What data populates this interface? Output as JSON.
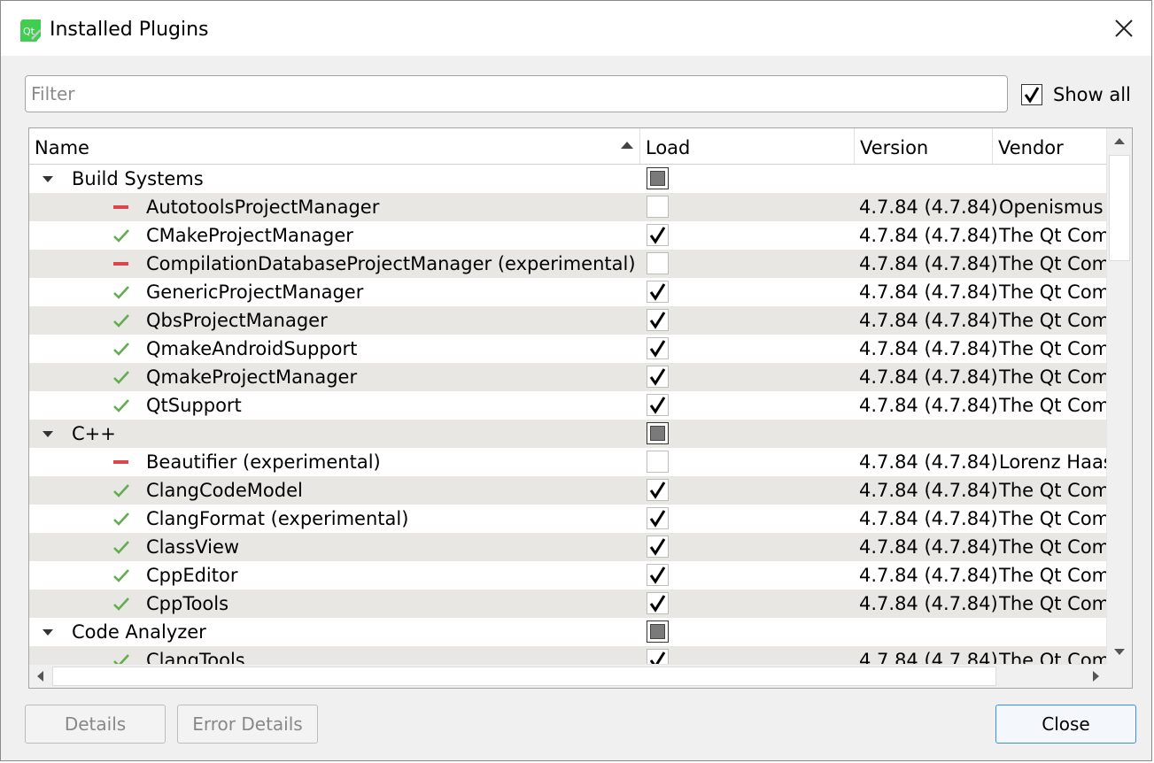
{
  "window": {
    "title": "Installed Plugins",
    "app_icon_text": "Qt"
  },
  "filter": {
    "placeholder": "Filter",
    "value": ""
  },
  "show_all": {
    "label": "Show all",
    "checked": true
  },
  "columns": [
    "Name",
    "Load",
    "Version",
    "Vendor"
  ],
  "groups": [
    {
      "name": "Build Systems",
      "plugins": [
        {
          "name": "AutotoolsProjectManager",
          "loaded": false,
          "version": "4.7.84 (4.7.84)",
          "vendor": "Openismus"
        },
        {
          "name": "CMakeProjectManager",
          "loaded": true,
          "version": "4.7.84 (4.7.84)",
          "vendor": "The Qt Com"
        },
        {
          "name": "CompilationDatabaseProjectManager (experimental)",
          "loaded": false,
          "version": "4.7.84 (4.7.84)",
          "vendor": "The Qt Com"
        },
        {
          "name": "GenericProjectManager",
          "loaded": true,
          "version": "4.7.84 (4.7.84)",
          "vendor": "The Qt Com"
        },
        {
          "name": "QbsProjectManager",
          "loaded": true,
          "version": "4.7.84 (4.7.84)",
          "vendor": "The Qt Com"
        },
        {
          "name": "QmakeAndroidSupport",
          "loaded": true,
          "version": "4.7.84 (4.7.84)",
          "vendor": "The Qt Com"
        },
        {
          "name": "QmakeProjectManager",
          "loaded": true,
          "version": "4.7.84 (4.7.84)",
          "vendor": "The Qt Com"
        },
        {
          "name": "QtSupport",
          "loaded": true,
          "version": "4.7.84 (4.7.84)",
          "vendor": "The Qt Com"
        }
      ]
    },
    {
      "name": "C++",
      "plugins": [
        {
          "name": "Beautifier (experimental)",
          "loaded": false,
          "version": "4.7.84 (4.7.84)",
          "vendor": "Lorenz Haas"
        },
        {
          "name": "ClangCodeModel",
          "loaded": true,
          "version": "4.7.84 (4.7.84)",
          "vendor": "The Qt Com"
        },
        {
          "name": "ClangFormat (experimental)",
          "loaded": true,
          "version": "4.7.84 (4.7.84)",
          "vendor": "The Qt Com"
        },
        {
          "name": "ClassView",
          "loaded": true,
          "version": "4.7.84 (4.7.84)",
          "vendor": "The Qt Com"
        },
        {
          "name": "CppEditor",
          "loaded": true,
          "version": "4.7.84 (4.7.84)",
          "vendor": "The Qt Com"
        },
        {
          "name": "CppTools",
          "loaded": true,
          "version": "4.7.84 (4.7.84)",
          "vendor": "The Qt Com"
        }
      ]
    },
    {
      "name": "Code Analyzer",
      "plugins": [
        {
          "name": "ClangTools",
          "loaded": true,
          "version": "4.7.84 (4.7.84)",
          "vendor": "The Qt Com"
        }
      ]
    }
  ],
  "buttons": {
    "details": "Details",
    "error_details": "Error Details",
    "close": "Close"
  },
  "colors": {
    "ok_check": "#5fb04a",
    "disabled_dash": "#d94848",
    "row_alt": "#e9e7e3",
    "primary_border": "#3c8ed9"
  }
}
